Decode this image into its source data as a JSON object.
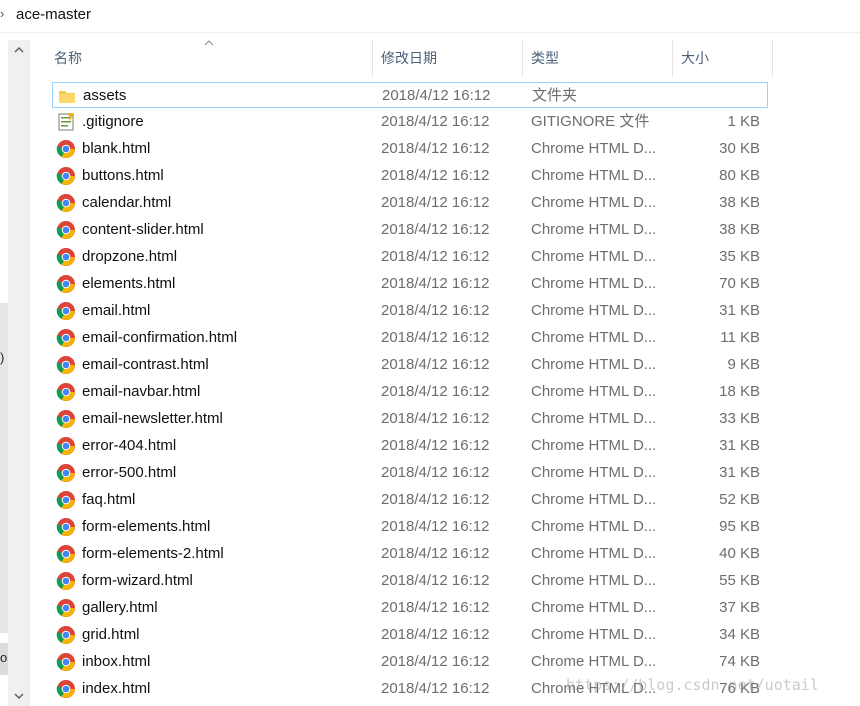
{
  "breadcrumb": {
    "path": "ace-master"
  },
  "left_pane": {
    "fragments": [
      ")",
      "o"
    ]
  },
  "columns": {
    "name": "名称",
    "date": "修改日期",
    "type": "类型",
    "size": "大小"
  },
  "files": [
    {
      "name": "assets",
      "date": "2018/4/12 16:12",
      "type": "文件夹",
      "size": "",
      "icon": "folder-icon",
      "selected": true
    },
    {
      "name": ".gitignore",
      "date": "2018/4/12 16:12",
      "type": "GITIGNORE 文件",
      "size": "1 KB",
      "icon": "text-file-icon"
    },
    {
      "name": "blank.html",
      "date": "2018/4/12 16:12",
      "type": "Chrome HTML D...",
      "size": "30 KB",
      "icon": "chrome-icon"
    },
    {
      "name": "buttons.html",
      "date": "2018/4/12 16:12",
      "type": "Chrome HTML D...",
      "size": "80 KB",
      "icon": "chrome-icon"
    },
    {
      "name": "calendar.html",
      "date": "2018/4/12 16:12",
      "type": "Chrome HTML D...",
      "size": "38 KB",
      "icon": "chrome-icon"
    },
    {
      "name": "content-slider.html",
      "date": "2018/4/12 16:12",
      "type": "Chrome HTML D...",
      "size": "38 KB",
      "icon": "chrome-icon"
    },
    {
      "name": "dropzone.html",
      "date": "2018/4/12 16:12",
      "type": "Chrome HTML D...",
      "size": "35 KB",
      "icon": "chrome-icon"
    },
    {
      "name": "elements.html",
      "date": "2018/4/12 16:12",
      "type": "Chrome HTML D...",
      "size": "70 KB",
      "icon": "chrome-icon"
    },
    {
      "name": "email.html",
      "date": "2018/4/12 16:12",
      "type": "Chrome HTML D...",
      "size": "31 KB",
      "icon": "chrome-icon"
    },
    {
      "name": "email-confirmation.html",
      "date": "2018/4/12 16:12",
      "type": "Chrome HTML D...",
      "size": "11 KB",
      "icon": "chrome-icon"
    },
    {
      "name": "email-contrast.html",
      "date": "2018/4/12 16:12",
      "type": "Chrome HTML D...",
      "size": "9 KB",
      "icon": "chrome-icon"
    },
    {
      "name": "email-navbar.html",
      "date": "2018/4/12 16:12",
      "type": "Chrome HTML D...",
      "size": "18 KB",
      "icon": "chrome-icon"
    },
    {
      "name": "email-newsletter.html",
      "date": "2018/4/12 16:12",
      "type": "Chrome HTML D...",
      "size": "33 KB",
      "icon": "chrome-icon"
    },
    {
      "name": "error-404.html",
      "date": "2018/4/12 16:12",
      "type": "Chrome HTML D...",
      "size": "31 KB",
      "icon": "chrome-icon"
    },
    {
      "name": "error-500.html",
      "date": "2018/4/12 16:12",
      "type": "Chrome HTML D...",
      "size": "31 KB",
      "icon": "chrome-icon"
    },
    {
      "name": "faq.html",
      "date": "2018/4/12 16:12",
      "type": "Chrome HTML D...",
      "size": "52 KB",
      "icon": "chrome-icon"
    },
    {
      "name": "form-elements.html",
      "date": "2018/4/12 16:12",
      "type": "Chrome HTML D...",
      "size": "95 KB",
      "icon": "chrome-icon"
    },
    {
      "name": "form-elements-2.html",
      "date": "2018/4/12 16:12",
      "type": "Chrome HTML D...",
      "size": "40 KB",
      "icon": "chrome-icon"
    },
    {
      "name": "form-wizard.html",
      "date": "2018/4/12 16:12",
      "type": "Chrome HTML D...",
      "size": "55 KB",
      "icon": "chrome-icon"
    },
    {
      "name": "gallery.html",
      "date": "2018/4/12 16:12",
      "type": "Chrome HTML D...",
      "size": "37 KB",
      "icon": "chrome-icon"
    },
    {
      "name": "grid.html",
      "date": "2018/4/12 16:12",
      "type": "Chrome HTML D...",
      "size": "34 KB",
      "icon": "chrome-icon"
    },
    {
      "name": "inbox.html",
      "date": "2018/4/12 16:12",
      "type": "Chrome HTML D...",
      "size": "74 KB",
      "icon": "chrome-icon"
    },
    {
      "name": "index.html",
      "date": "2018/4/12 16:12",
      "type": "Chrome HTML D...",
      "size": "76 KB",
      "icon": "chrome-icon"
    }
  ],
  "watermark": "https://blog.csdn.net/uotail",
  "colors": {
    "header_text": "#4c607a",
    "selection_border": "#99d1ff",
    "folder": "#f6c94a",
    "chrome_red": "#db4437",
    "chrome_green": "#0f9d58",
    "chrome_yellow": "#f4b400",
    "chrome_blue": "#4285f4"
  }
}
